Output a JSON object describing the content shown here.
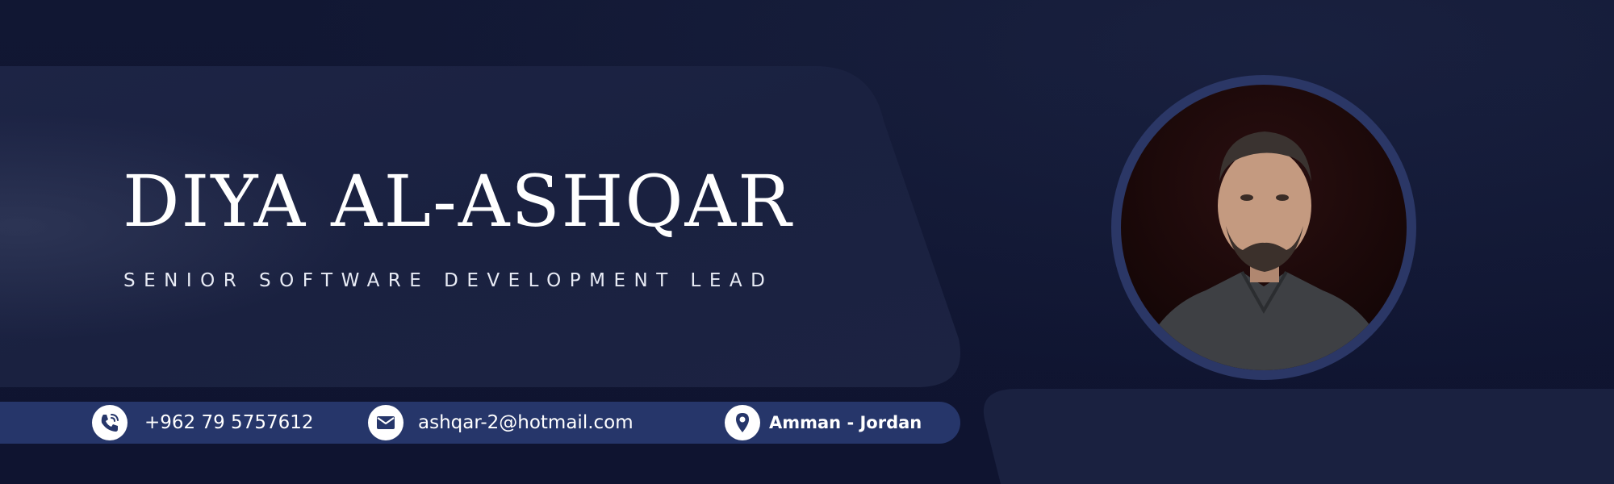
{
  "profile": {
    "name": "DIYA AL-ASHQAR",
    "title": "SENIOR SOFTWARE DEVELOPMENT LEAD"
  },
  "contact": {
    "phone": {
      "icon": "phone-icon",
      "text": "+962 79 5757612"
    },
    "email": {
      "icon": "email-icon",
      "text": "ashqar-2@hotmail.com"
    },
    "location": {
      "icon": "location-pin-icon",
      "text": "Amman - Jordan"
    }
  },
  "colors": {
    "background": "#101530",
    "panel": "#1a2140",
    "contact_bar": "#26366a",
    "avatar_ring": "#2b3766",
    "text": "#ffffff"
  }
}
